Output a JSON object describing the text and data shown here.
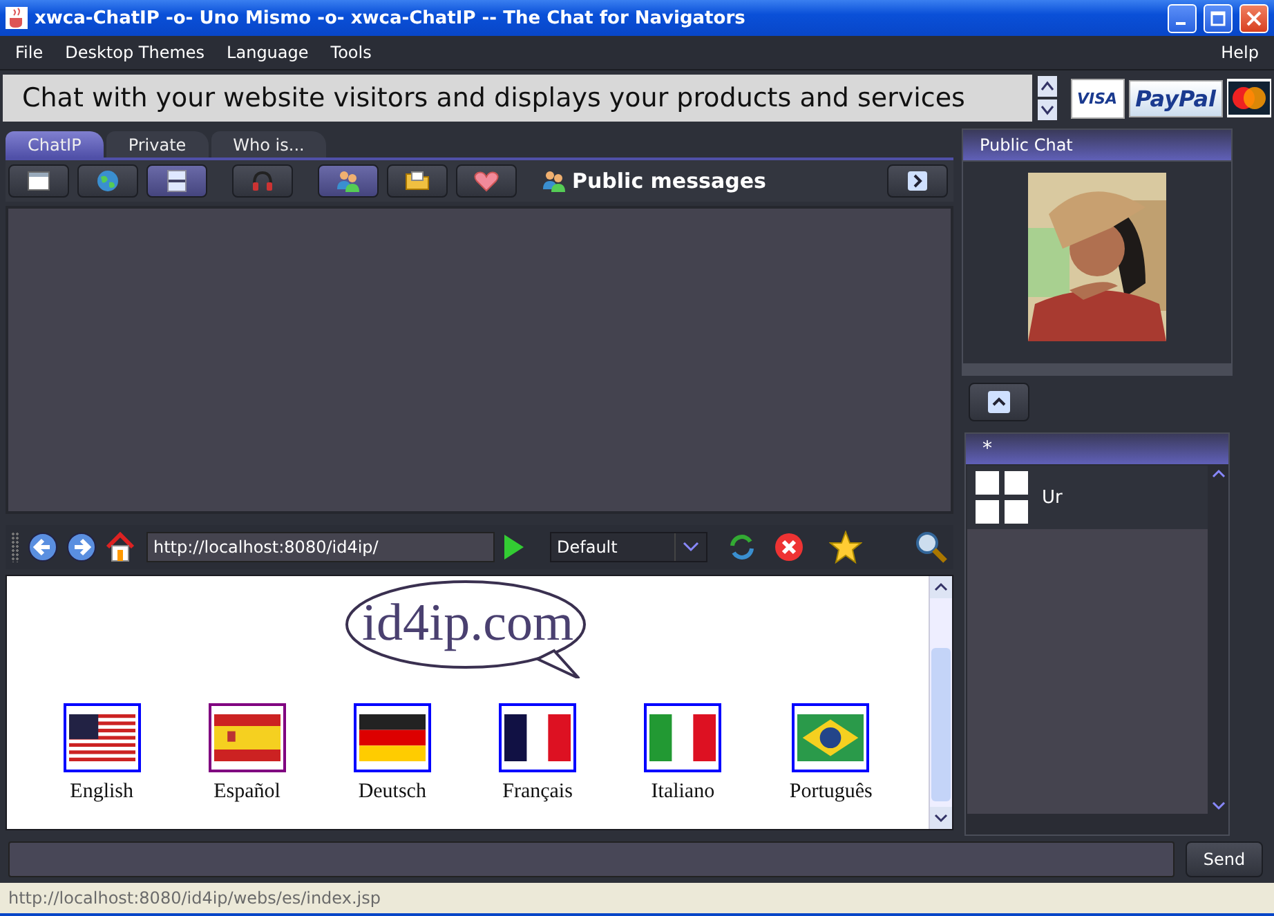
{
  "window": {
    "title": "xwca-ChatIP -o- Uno Mismo -o- xwca-ChatIP -- The Chat for Navigators"
  },
  "menu": {
    "left": [
      "File",
      "Desktop Themes",
      "Language",
      "Tools"
    ],
    "right": [
      "Help"
    ]
  },
  "banner": {
    "text": "Chat with your website visitors and displays your products and services",
    "cards": [
      {
        "kind": "visa",
        "label": "VISA"
      },
      {
        "kind": "paypal",
        "label": "PayPal"
      },
      {
        "kind": "mastercard"
      }
    ]
  },
  "tabs": [
    {
      "label": "ChatIP",
      "selected": true
    },
    {
      "label": "Private",
      "selected": false
    },
    {
      "label": "Who is...",
      "selected": false
    }
  ],
  "toolbar": {
    "buttons": [
      {
        "kind": "window",
        "selected": false
      },
      {
        "kind": "globe",
        "selected": false
      },
      {
        "kind": "panel",
        "selected": true
      },
      {
        "kind": "headphones",
        "selected": false
      },
      {
        "kind": "users",
        "selected": true
      },
      {
        "kind": "folder",
        "selected": false
      },
      {
        "kind": "heart",
        "selected": false
      }
    ],
    "title": "Public messages"
  },
  "browser": {
    "address": "http://localhost:8080/id4ip/",
    "profile": "Default",
    "logo": "id4ip.com",
    "languages": [
      {
        "label": "English",
        "kind": "us",
        "visited": false
      },
      {
        "label": "Español",
        "kind": "es",
        "visited": true
      },
      {
        "label": "Deutsch",
        "kind": "de",
        "visited": false
      },
      {
        "label": "Français",
        "kind": "fr",
        "visited": false
      },
      {
        "label": "Italiano",
        "kind": "it",
        "visited": false
      },
      {
        "label": "Português",
        "kind": "br",
        "visited": false
      }
    ]
  },
  "side": {
    "title": "Public Chat",
    "list_header": "*",
    "users": [
      {
        "name": "Ur",
        "selected": true
      }
    ]
  },
  "send": "Send",
  "status_bar": "http://localhost:8080/id4ip/webs/es/index.jsp"
}
